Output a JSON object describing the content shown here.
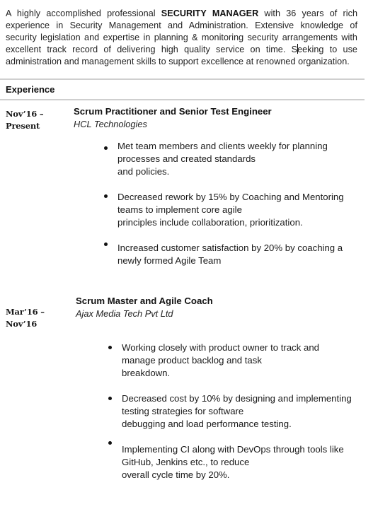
{
  "summary": {
    "prefix": "A highly accomplished professional ",
    "highlight": "SECURITY MANAGER",
    "suffix_before_caret": " with 36 years of rich experience in Security Management and Administration. Extensive knowledge of security legislation and expertise in planning & monitoring security arrangements with excellent track record of delivering high quality service on time. S",
    "suffix_after_caret": "eeking to use administration and management skills to support excellence at renowned organization."
  },
  "section": {
    "title": "Experience"
  },
  "jobs": [
    {
      "date_start": "Nov’16 –",
      "date_end": "Present",
      "title": "Scrum Practitioner and Senior Test Engineer",
      "company": "HCL Technologies",
      "bullets": [
        [
          "Met team members and clients weekly for planning",
          "processes and created standards",
          "and policies."
        ],
        [
          "Decreased rework by 15% by Coaching and Mentoring",
          "teams to implement core agile",
          "principles include collaboration, prioritization."
        ],
        [
          "Increased customer satisfaction by 20% by coaching a",
          "newly formed Agile Team"
        ]
      ]
    },
    {
      "date_start": "Mar’16 –",
      "date_end": "Nov’16",
      "title": "Scrum Master and Agile Coach",
      "company": "Ajax Media Tech Pvt Ltd",
      "bullets": [
        [
          "Working closely with product owner to track and",
          "manage product backlog and task",
          "breakdown."
        ],
        [
          "Decreased cost by 10% by designing and implementing",
          "testing strategies for software",
          "debugging and load performance testing."
        ],
        [
          "Implementing CI along with DevOps through tools like",
          "GitHub, Jenkins etc., to reduce",
          "overall cycle time by 20%."
        ]
      ]
    }
  ]
}
